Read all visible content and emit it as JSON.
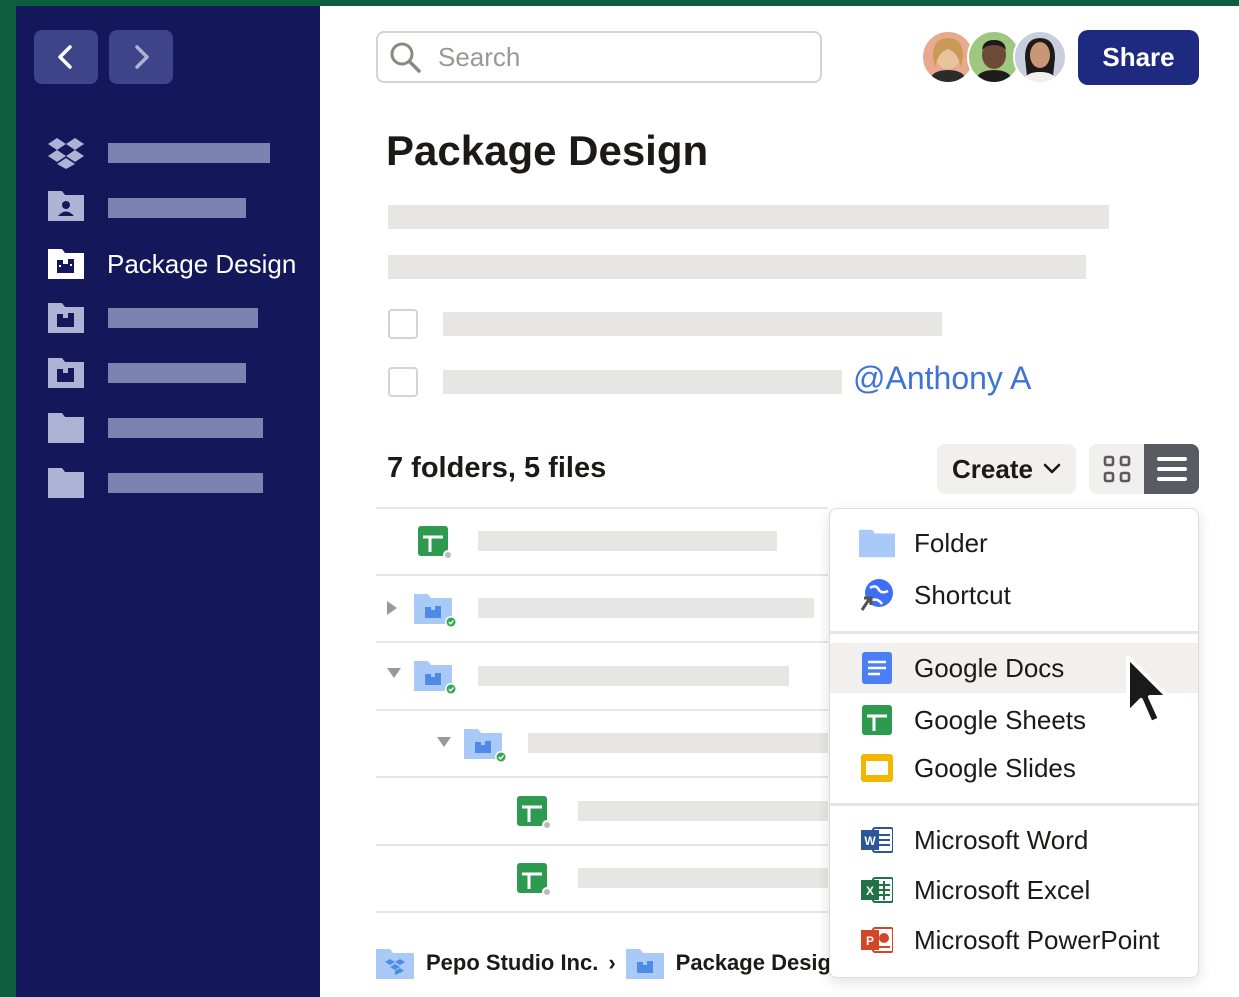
{
  "search": {
    "placeholder": "Search"
  },
  "header": {
    "share_label": "Share"
  },
  "sidebar": {
    "active_label": "Package Design"
  },
  "page": {
    "title": "Package Design",
    "mention": "@Anthony A"
  },
  "files": {
    "count_label": "7 folders, 5 files",
    "create_label": "Create"
  },
  "menu": {
    "items": [
      {
        "label": "Folder",
        "icon": "folder-icon"
      },
      {
        "label": "Shortcut",
        "icon": "shortcut-icon"
      },
      {
        "label": "Google Docs",
        "icon": "google-docs-icon"
      },
      {
        "label": "Google Sheets",
        "icon": "google-sheets-icon"
      },
      {
        "label": "Google Slides",
        "icon": "google-slides-icon"
      },
      {
        "label": "Microsoft Word",
        "icon": "word-icon"
      },
      {
        "label": "Microsoft Excel",
        "icon": "excel-icon"
      },
      {
        "label": "Microsoft PowerPoint",
        "icon": "powerpoint-icon"
      }
    ]
  },
  "breadcrumb": {
    "root": "Pepo Studio Inc.",
    "current": "Package Design"
  },
  "colors": {
    "sidebar": "#14175a",
    "share": "#1e2a80",
    "mention": "#3d74d6",
    "frame": "#0c5e3e"
  }
}
